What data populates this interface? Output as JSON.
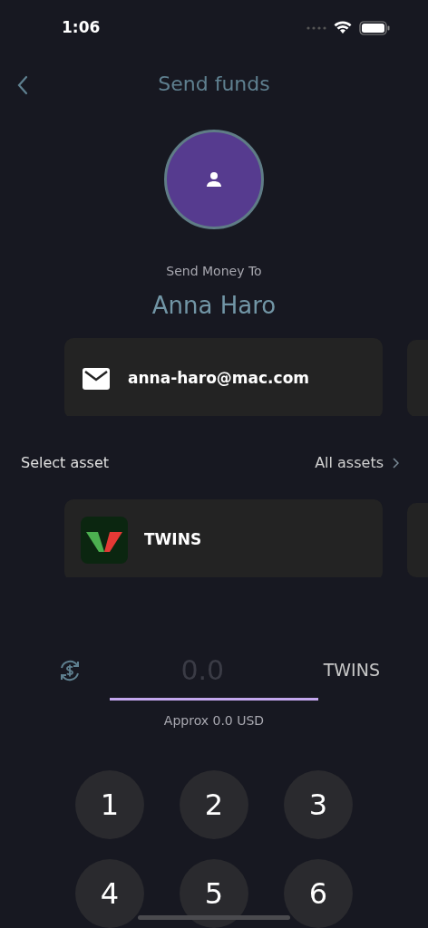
{
  "status_bar": {
    "time": "1:06"
  },
  "nav": {
    "title": "Send funds"
  },
  "recipient": {
    "caption": "Send Money To",
    "name": "Anna Haro"
  },
  "contact_cards": [
    {
      "kind": "email",
      "value": "anna-haro@mac.com"
    }
  ],
  "asset_header": {
    "label": "Select asset",
    "link": "All assets"
  },
  "asset_cards": [
    {
      "name": "TWINS"
    }
  ],
  "amount": {
    "placeholder": "0.0",
    "unit": "TWINS",
    "approx": "Approx 0.0 USD"
  },
  "keypad": [
    "1",
    "2",
    "3",
    "4",
    "5",
    "6"
  ]
}
